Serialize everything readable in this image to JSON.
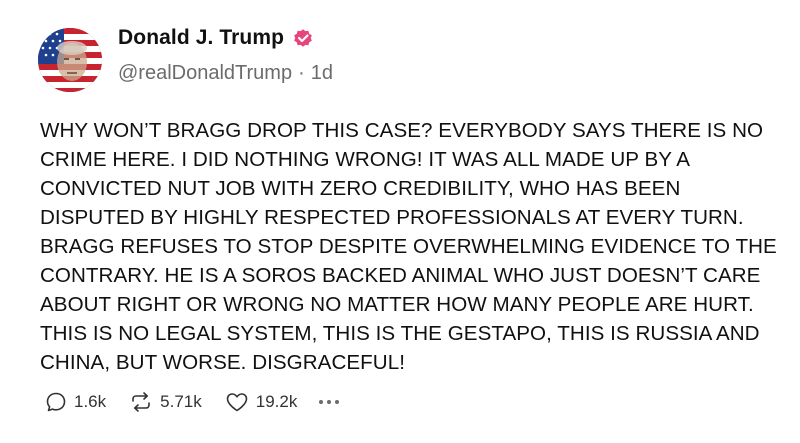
{
  "post": {
    "author": {
      "display_name": "Donald J. Trump",
      "handle": "@realDonaldTrump",
      "verified": true,
      "verified_color": "#e8457a"
    },
    "separator": "·",
    "age": "1d",
    "text": "WHY WON’T BRAGG DROP THIS CASE? EVERYBODY SAYS THERE IS NO\nCRIME HERE. I DID NOTHING WRONG! IT WAS ALL MADE UP BY A\nCONVICTED NUT JOB WITH ZERO CREDIBILITY, WHO HAS BEEN\nDISPUTED BY HIGHLY RESPECTED PROFESSIONALS AT EVERY TURN.\nBRAGG REFUSES TO STOP DESPITE OVERWHELMING EVIDENCE TO THE\nCONTRARY. HE IS A SOROS BACKED ANIMAL WHO JUST DOESN’T CARE\nABOUT RIGHT OR WRONG NO MATTER HOW MANY PEOPLE ARE HURT.\nTHIS IS NO LEGAL SYSTEM, THIS IS THE GESTAPO, THIS IS RUSSIA AND\nCHINA, BUT WORSE. DISGRACEFUL!",
    "actions": {
      "replies": "1.6k",
      "reposts": "5.71k",
      "likes": "19.2k"
    },
    "icons": {
      "reply": "comment-bubble-icon",
      "repost": "repost-arrows-icon",
      "like": "heart-icon",
      "more": "more-dots-icon"
    }
  }
}
